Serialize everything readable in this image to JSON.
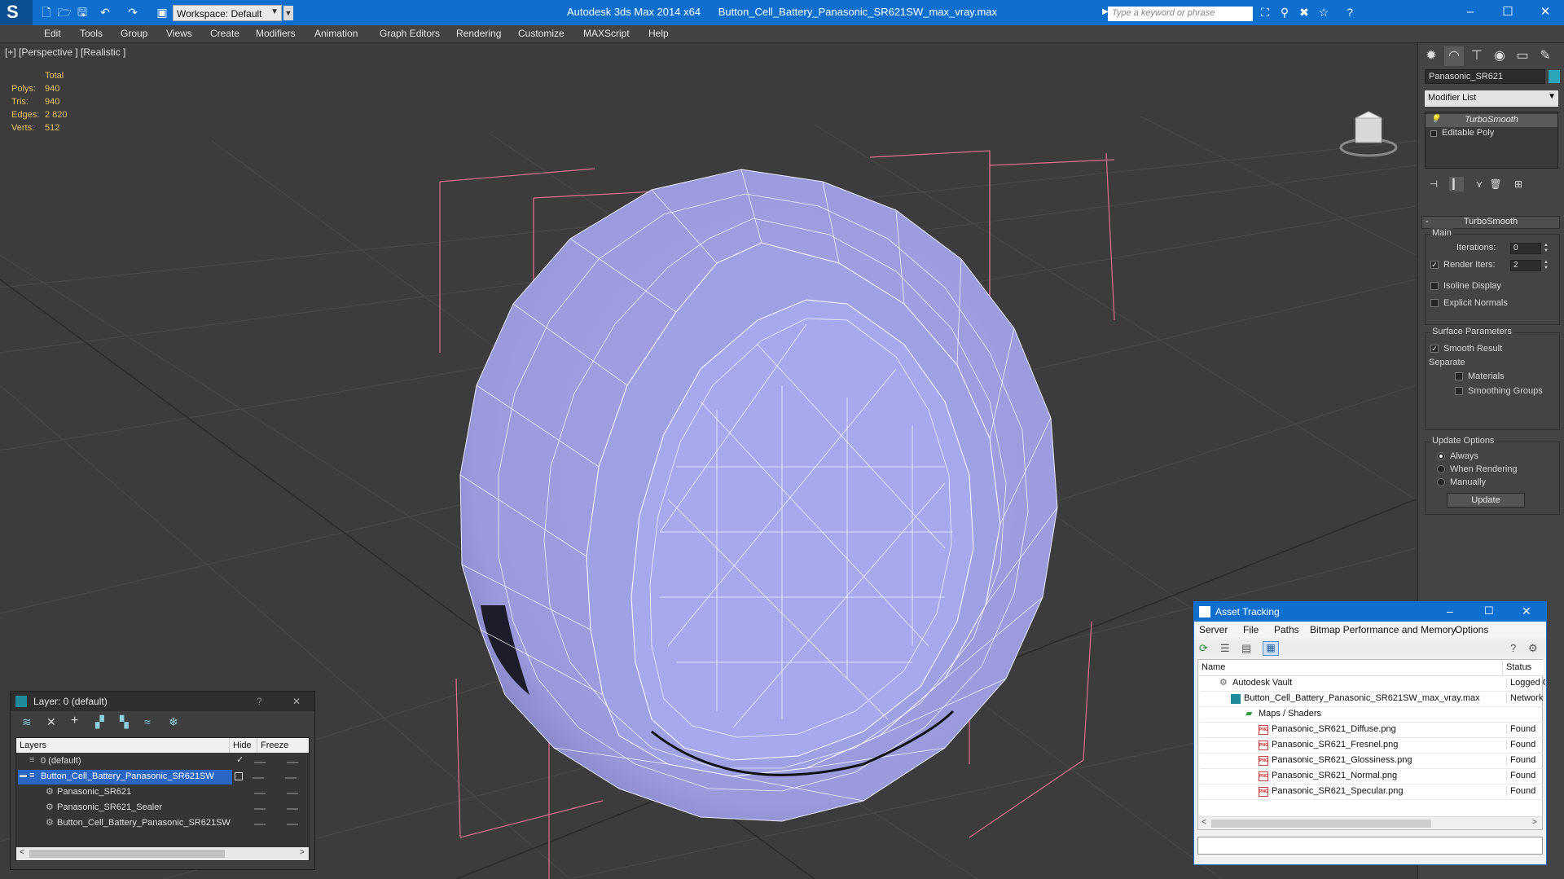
{
  "titlebar": {
    "app_title": "Autodesk 3ds Max  2014 x64",
    "file_title": "Button_Cell_Battery_Panasonic_SR621SW_max_vray.max",
    "workspace": "Workspace: Default",
    "search_placeholder": "Type a keyword or phrase"
  },
  "menu": [
    "Edit",
    "Tools",
    "Group",
    "Views",
    "Create",
    "Modifiers",
    "Animation",
    "Graph Editors",
    "Rendering",
    "Customize",
    "MAXScript",
    "Help"
  ],
  "viewport": {
    "label": "[+] [Perspective ] [Realistic ]",
    "stats": {
      "header": "Total",
      "rows": [
        {
          "k": "Polys:",
          "v": "940"
        },
        {
          "k": "Tris:",
          "v": "940"
        },
        {
          "k": "Edges:",
          "v": "2 820"
        },
        {
          "k": "Verts:",
          "v": "512"
        }
      ]
    }
  },
  "command_panel": {
    "object_name": "Panasonic_SR621",
    "object_color": "#2aa6b8",
    "modifier_list": "Modifier List",
    "stack": [
      "TurboSmooth",
      "Editable Poly"
    ],
    "rollout_title": "TurboSmooth",
    "main_group": "Main",
    "iterations_label": "Iterations:",
    "iterations_value": "0",
    "render_iters_label": "Render Iters:",
    "render_iters_value": "2",
    "render_iters_checked": true,
    "isoline": "Isoline Display",
    "explicit_normals": "Explicit Normals",
    "surface_group": "Surface Parameters",
    "smooth_result": "Smooth Result",
    "separate": "Separate",
    "materials": "Materials",
    "smoothing_groups": "Smoothing Groups",
    "update_group": "Update Options",
    "always": "Always",
    "when_rendering": "When Rendering",
    "manually": "Manually",
    "update_button": "Update"
  },
  "layer_window": {
    "title": "Layer: 0 (default)",
    "help": "?",
    "close": "✕",
    "col_layers": "Layers",
    "col_hide": "Hide",
    "col_freeze": "Freeze",
    "rows": [
      {
        "label": "0 (default)"
      },
      {
        "label": "Button_Cell_Battery_Panasonic_SR621SW"
      },
      {
        "label": "Panasonic_SR621"
      },
      {
        "label": "Panasonic_SR621_Sealer"
      },
      {
        "label": "Button_Cell_Battery_Panasonic_SR621SW"
      }
    ]
  },
  "asset_window": {
    "title": "Asset Tracking",
    "menu": [
      "Server",
      "File",
      "Paths",
      "Bitmap Performance and Memory",
      "Options"
    ],
    "col_name": "Name",
    "col_status": "Status",
    "rows": [
      {
        "name": "Autodesk Vault",
        "status": "Logged C"
      },
      {
        "name": "Button_Cell_Battery_Panasonic_SR621SW_max_vray.max",
        "status": "Network"
      },
      {
        "name": "Maps / Shaders",
        "status": ""
      },
      {
        "name": "Panasonic_SR621_Diffuse.png",
        "status": "Found"
      },
      {
        "name": "Panasonic_SR621_Fresnel.png",
        "status": "Found"
      },
      {
        "name": "Panasonic_SR621_Glossiness.png",
        "status": "Found"
      },
      {
        "name": "Panasonic_SR621_Normal.png",
        "status": "Found"
      },
      {
        "name": "Panasonic_SR621_Specular.png",
        "status": "Found"
      }
    ]
  }
}
